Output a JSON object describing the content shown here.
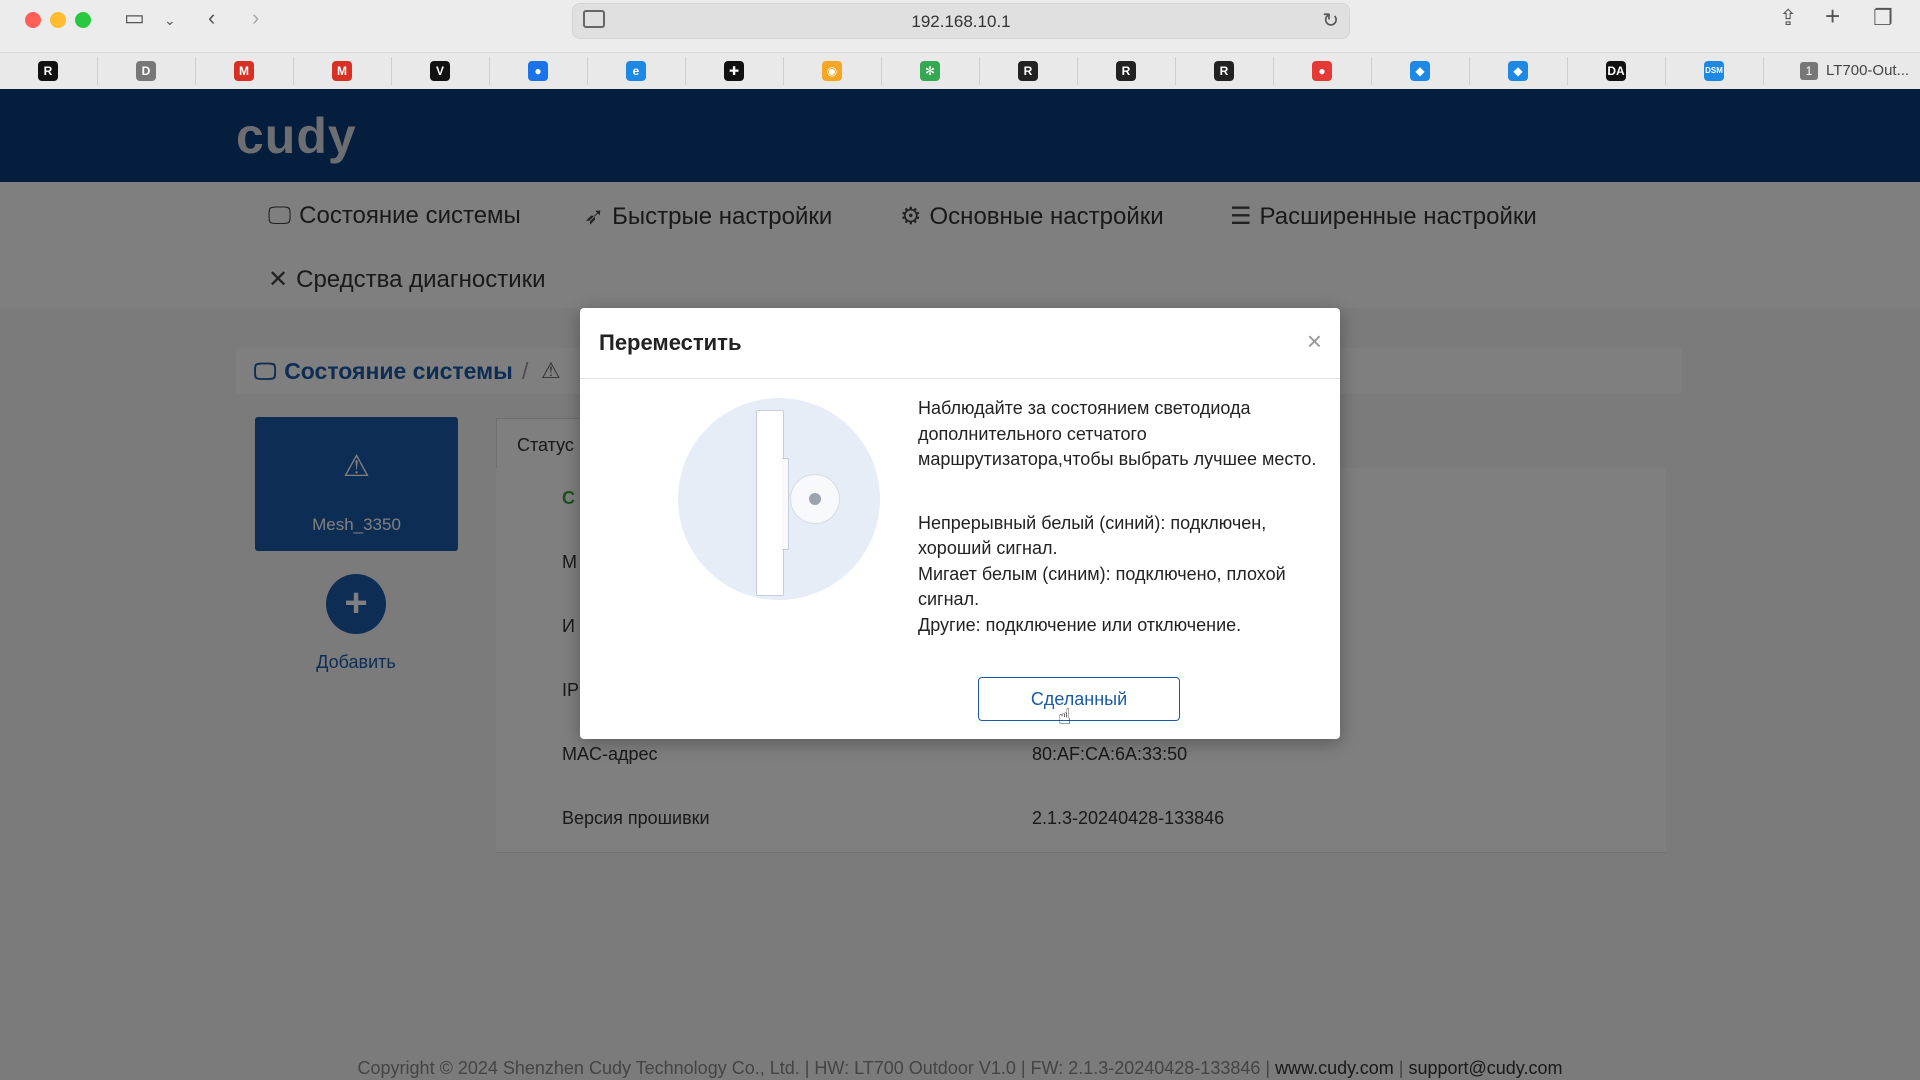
{
  "browser": {
    "url": "192.168.10.1",
    "tab_count": "1",
    "tab_title": "LT700-Out..."
  },
  "favorites": [
    {
      "icon": "r-icon",
      "glyph": "R",
      "color": "#111111"
    },
    {
      "icon": "d-icon",
      "glyph": "D",
      "color": "#777777"
    },
    {
      "icon": "gmail-icon",
      "glyph": "M",
      "color": "#d93025"
    },
    {
      "icon": "mail-icon",
      "glyph": "M",
      "color": "#d93025"
    },
    {
      "icon": "v-icon",
      "glyph": "V",
      "color": "#111111"
    },
    {
      "icon": "chat-icon",
      "glyph": "●",
      "color": "#1a73e8"
    },
    {
      "icon": "edge-icon",
      "glyph": "e",
      "color": "#1e88e5"
    },
    {
      "icon": "compass-icon",
      "glyph": "✚",
      "color": "#111111"
    },
    {
      "icon": "globe-icon",
      "glyph": "◉",
      "color": "#f5a623"
    },
    {
      "icon": "pinwheel-icon",
      "glyph": "✻",
      "color": "#34a853"
    },
    {
      "icon": "r-red-icon",
      "glyph": "R",
      "color": "#222222"
    },
    {
      "icon": "r2-icon",
      "glyph": "R",
      "color": "#222222"
    },
    {
      "icon": "r3-icon",
      "glyph": "R",
      "color": "#222222"
    },
    {
      "icon": "red-circle-icon",
      "glyph": "●",
      "color": "#e53935"
    },
    {
      "icon": "bird-icon",
      "glyph": "◆",
      "color": "#1e88e5"
    },
    {
      "icon": "bird2-icon",
      "glyph": "◆",
      "color": "#1e88e5"
    },
    {
      "icon": "da-icon",
      "glyph": "DA",
      "color": "#111111"
    },
    {
      "icon": "dsm-icon",
      "glyph": "DSM",
      "color": "#1e88e5"
    }
  ],
  "header": {
    "logo": "cudy"
  },
  "nav": {
    "status": "Состояние системы",
    "quick": "Быстрые настройки",
    "basic": "Основные настройки",
    "advanced": "Расширенные настройки",
    "diagnostics": "Средства диагностики"
  },
  "breadcrumb": {
    "main": "Состояние системы",
    "sep": "/"
  },
  "node": {
    "name": "Mesh_3350"
  },
  "add": {
    "label": "Добавить"
  },
  "panel": {
    "tab": "Статус",
    "rows": [
      {
        "key": "С",
        "value": ""
      },
      {
        "key": "М",
        "value": ""
      },
      {
        "key": "И",
        "value": ""
      },
      {
        "key": "IP",
        "value": ""
      },
      {
        "key": "MAC-адрес",
        "value": "80:AF:CA:6A:33:50"
      },
      {
        "key": "Версия прошивки",
        "value": "2.1.3-20240428-133846"
      }
    ]
  },
  "footer": {
    "copyright": "Copyright © 2024 Shenzhen Cudy Technology Co., Ltd.  |  HW: LT700 Outdoor V1.0  |  FW: 2.1.3-20240428-133846  |  ",
    "site": "www.cudy.com",
    "sep": "  |  ",
    "email": "support@cudy.com"
  },
  "modal": {
    "title": "Переместить",
    "close": "×",
    "msg1": "Наблюдайте за состоянием светодиода дополнительного сетчатого маршрутизатора,чтобы выбрать лучшее место.",
    "msg2": "Непрерывный белый (синий): подключен, хороший сигнал.",
    "msg3": "Мигает белым (синим): подключено, плохой сигнал.",
    "msg4": "Другие: подключение или отключение.",
    "button": "Сделанный"
  }
}
